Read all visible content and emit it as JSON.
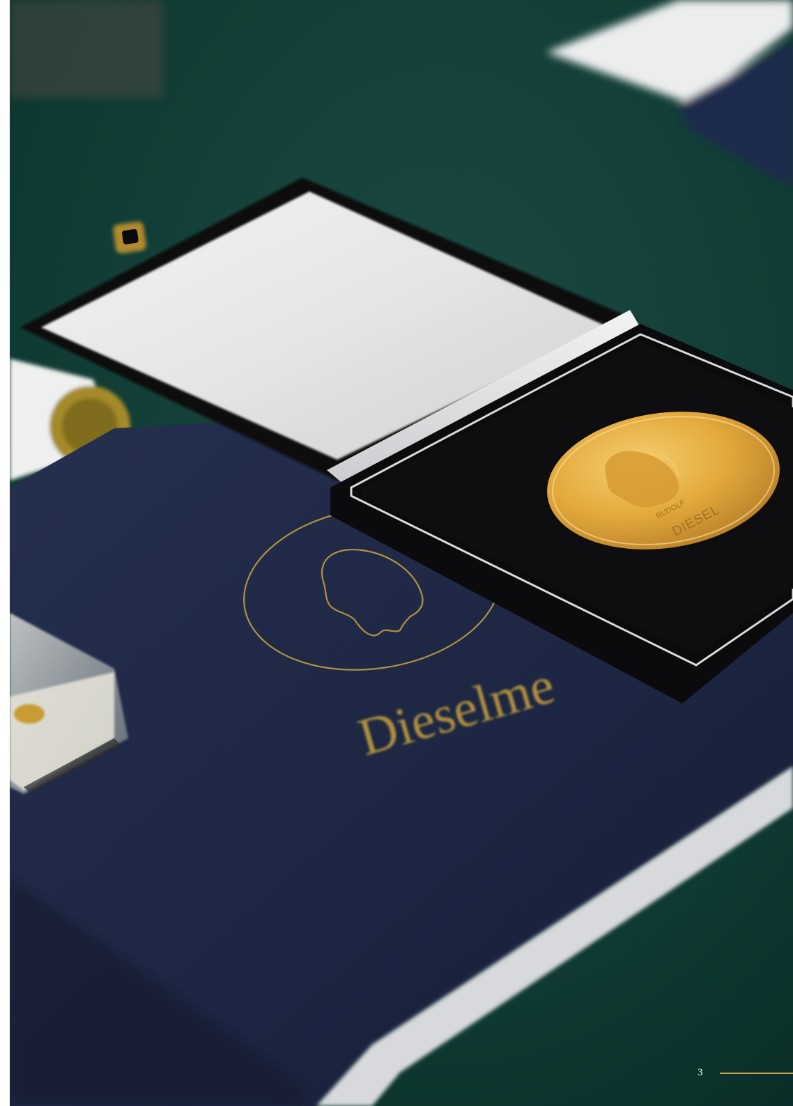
{
  "page": {
    "number": "3"
  },
  "photo": {
    "subject": "Diesel medal in open presentation case on navy book with gold emblem",
    "book_title_fragment": "Dieselme",
    "medal_inscription_line1": "RUDOLF",
    "medal_inscription_line2": "DIESEL"
  },
  "colors": {
    "background_green": "#0f3a33",
    "book_navy": "#1d2742",
    "gold": "#c9a24a",
    "case_black": "#0b0b0d",
    "satin_white": "#e9eaea",
    "rule_gold": "#c9a24a"
  }
}
